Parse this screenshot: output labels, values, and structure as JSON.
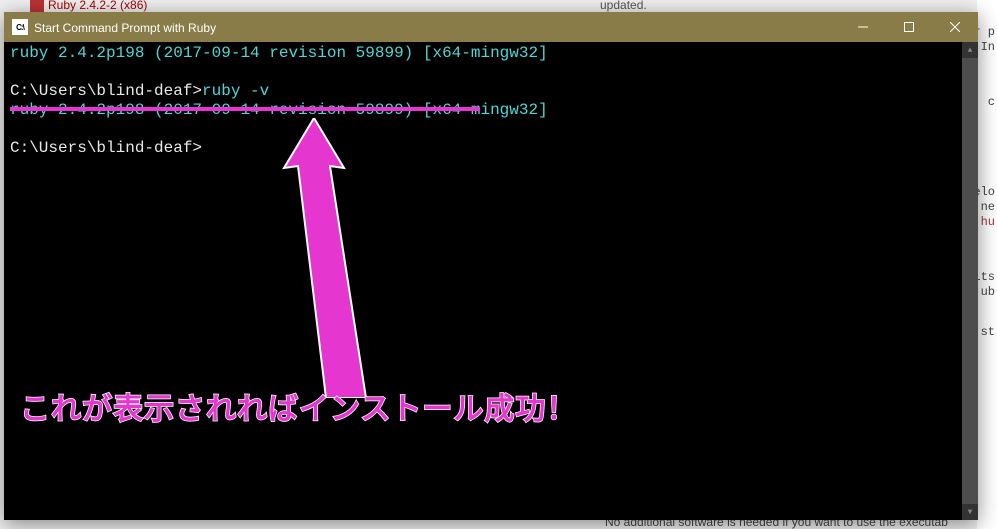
{
  "background": {
    "tab_label": "Ruby 2.4.2-2 (x86)",
    "updated": "updated.",
    "bottom": "No additional software is needed if you want to use the executab",
    "right_fragments": [
      "r p",
      "In",
      "c",
      "elo",
      "ne",
      "hu",
      "its",
      "ub",
      "st"
    ]
  },
  "window": {
    "title": "Start Command Prompt with Ruby",
    "icon_text": "C:\\"
  },
  "terminal": {
    "line1": "ruby 2.4.2p198 (2017-09-14 revision 59899) [x64-mingw32]",
    "line2_prompt": "C:\\Users\\blind-deaf>",
    "line2_cmd": "ruby -v",
    "line3": "ruby 2.4.2p198 (2017-09-14 revision 59899) [x64-mingw32]",
    "line4_prompt": "C:\\Users\\blind-deaf>"
  },
  "annotation": {
    "callout": "これが表示されればインストール成功！"
  }
}
